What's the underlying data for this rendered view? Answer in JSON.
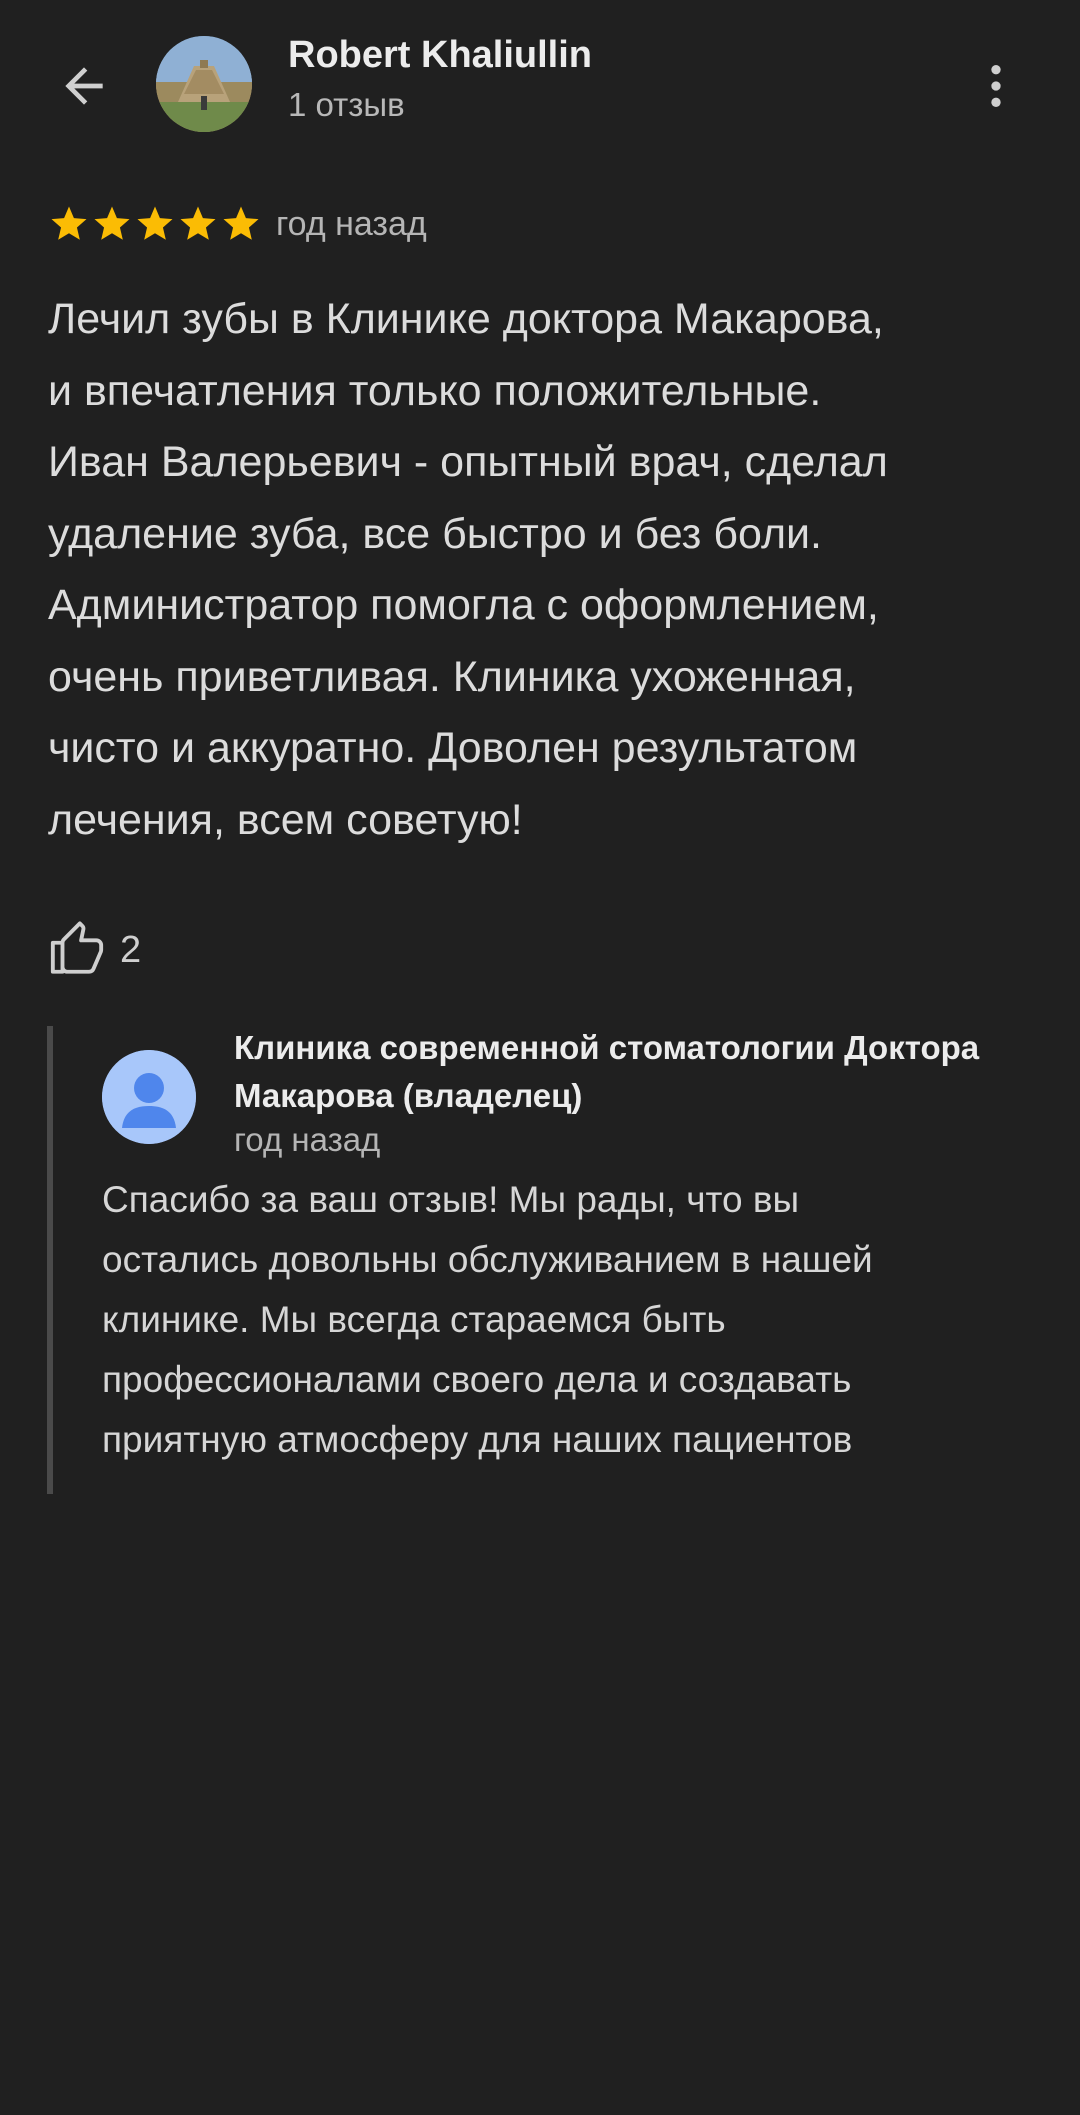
{
  "reviewer": {
    "name": "Robert Khaliullin",
    "review_count": "1 отзыв"
  },
  "review": {
    "rating": 5,
    "max_rating": 5,
    "time": "год назад",
    "text": "Лечил зубы в Клинике доктора Макарова,\nи впечатления только положительные.\nИван Валерьевич - опытный врач, сделал\nудаление зуба, все быстро и без боли.\nАдминистратор помогла с оформлением,\nочень приветливая. Клиника ухоженная,\nчисто и аккуратно. Доволен результатом\nлечения, всем советую!",
    "likes": "2"
  },
  "owner_reply": {
    "name": "Клиника современной стоматологии Доктора Макарова (владелец)",
    "time": "год назад",
    "text": "Спасибо за ваш отзыв! Мы рады, что вы\nостались довольны обслуживанием в нашей\nклинике. Мы всегда стараемся быть\nпрофессионалами своего дела и создавать\nприятную атмосферу для наших пациентов"
  },
  "colors": {
    "background": "#202020",
    "star": "#fbbc04",
    "owner_avatar": "#a8c7fa"
  },
  "icons": {
    "back": "arrow-back-icon",
    "more": "more-vert-icon",
    "like": "thumb-up-icon",
    "star": "star-icon",
    "owner_avatar": "person-icon"
  }
}
